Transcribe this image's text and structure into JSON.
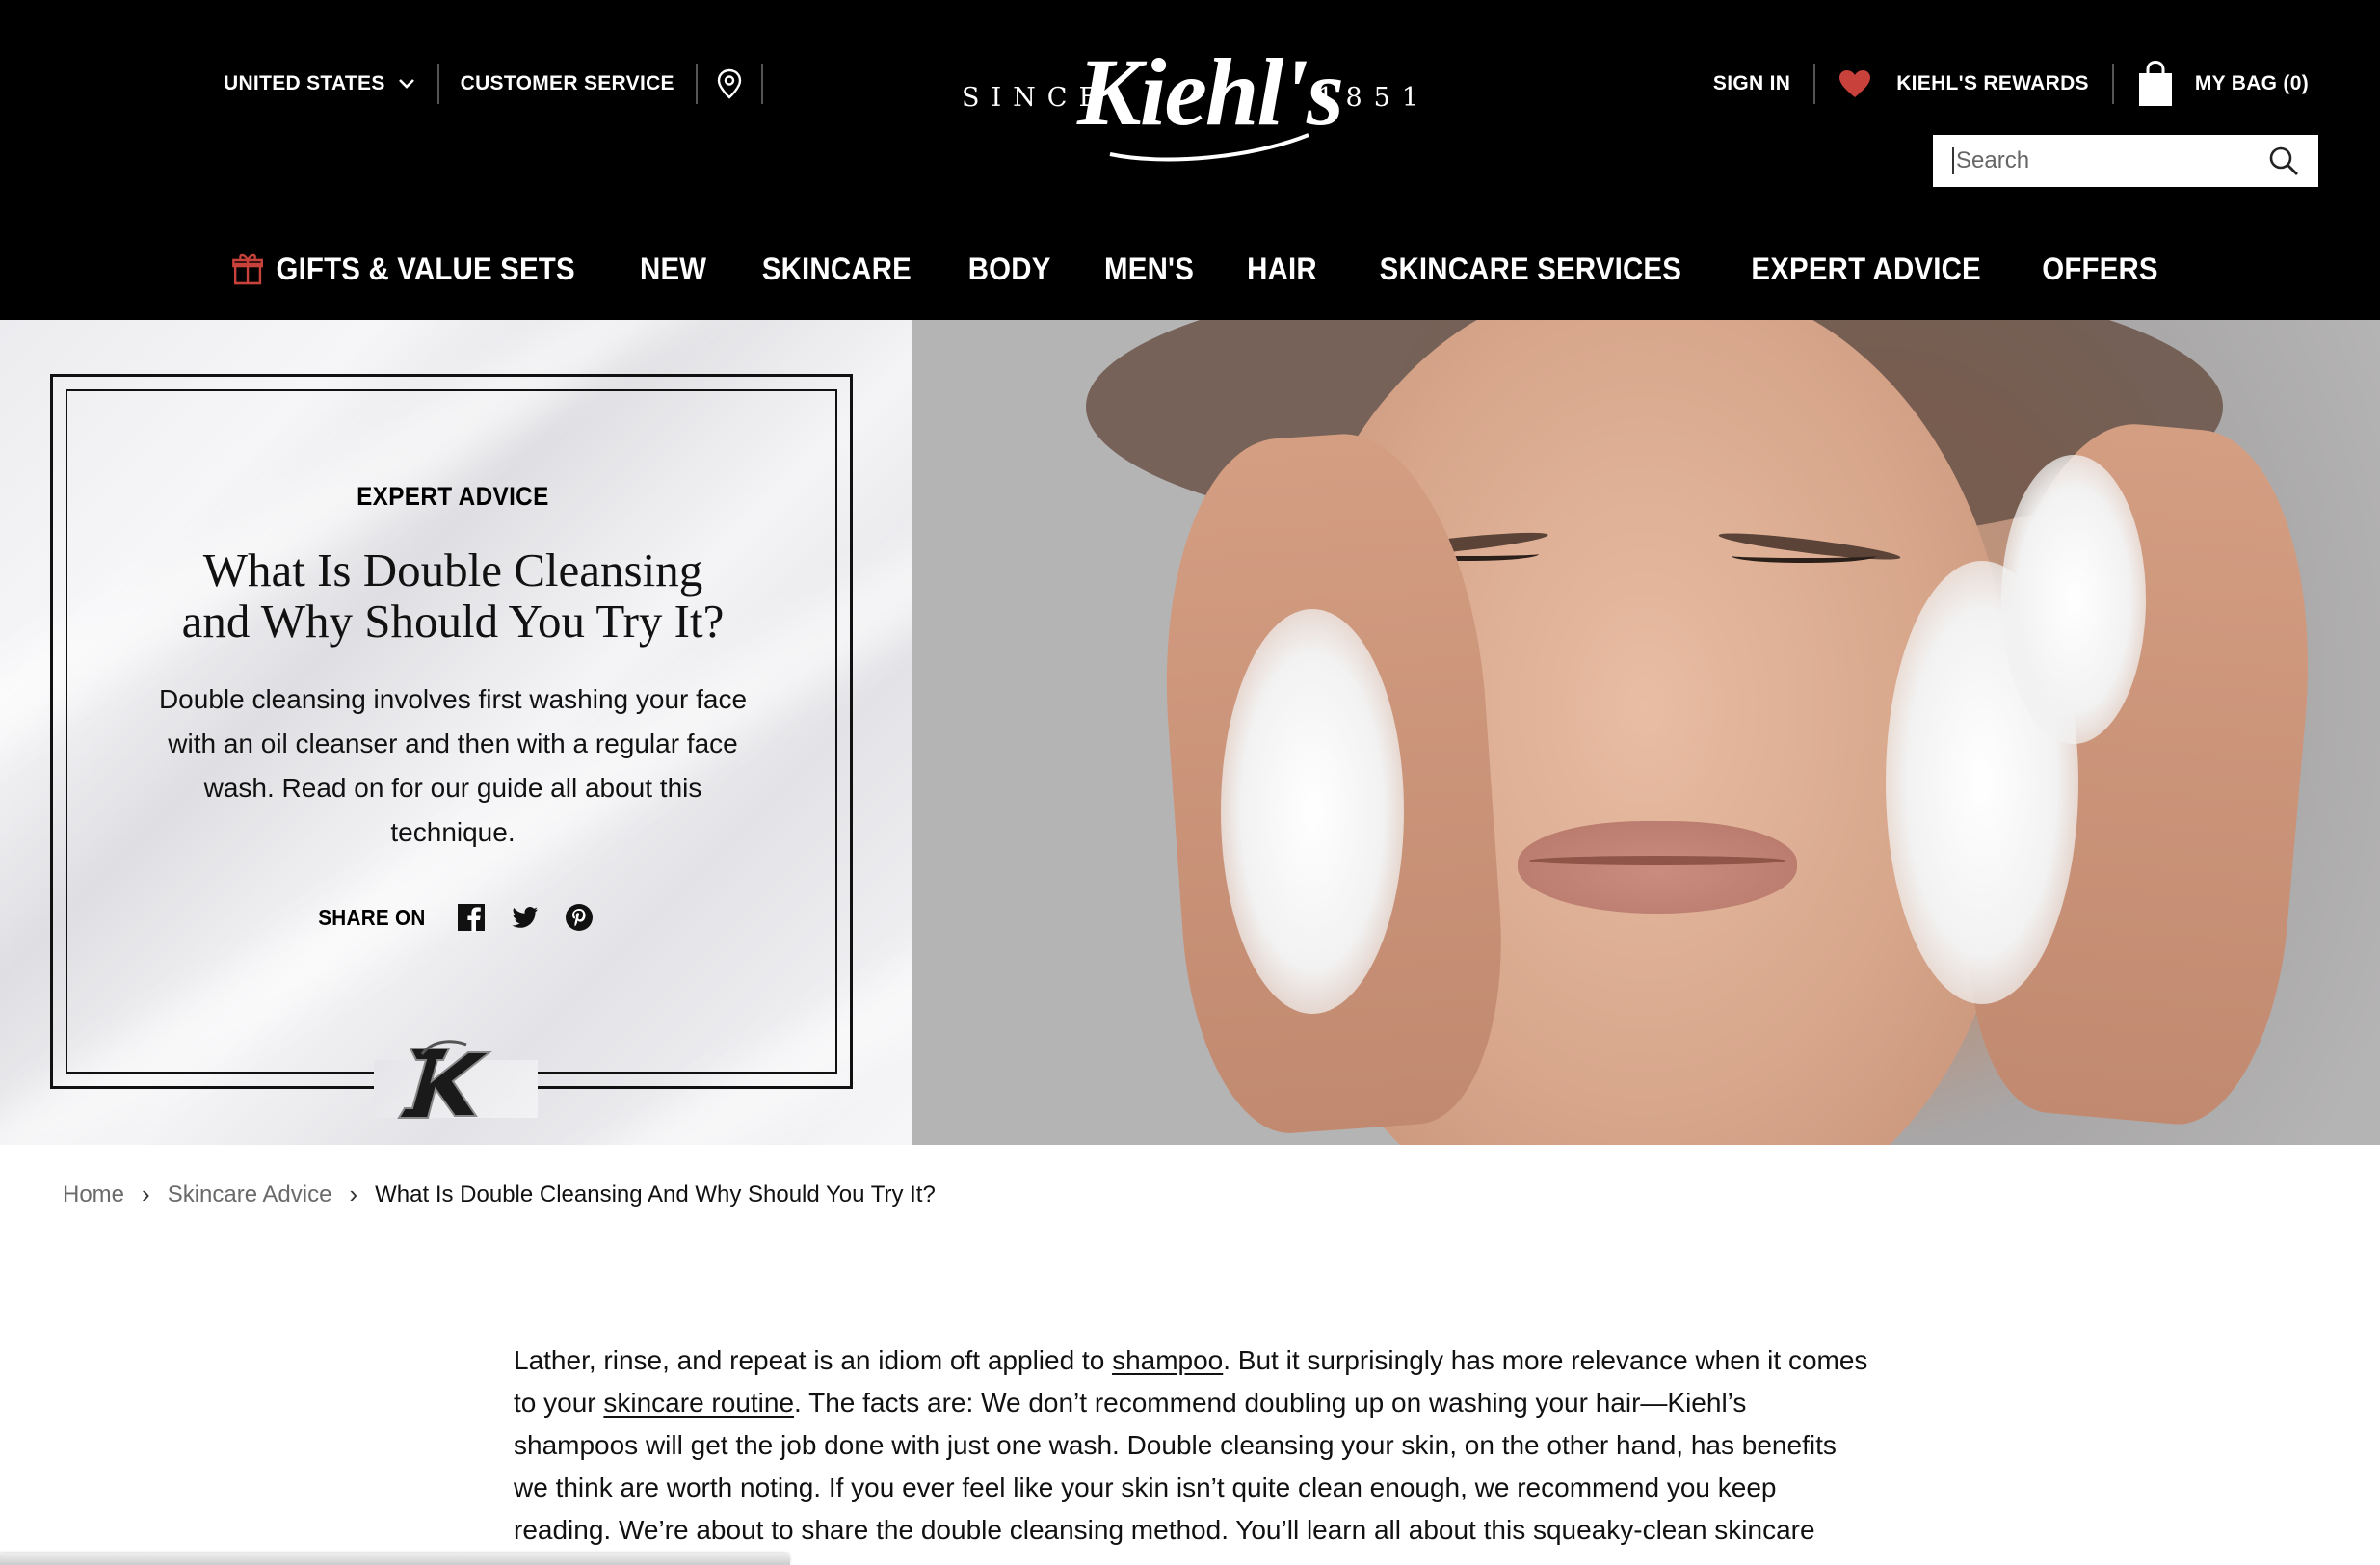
{
  "header": {
    "country": "UNITED STATES",
    "customer_service": "CUSTOMER SERVICE",
    "logo": {
      "since": "SINCE",
      "name": "Kiehl's",
      "year": "1851"
    },
    "sign_in": "SIGN IN",
    "rewards": "KIEHL'S REWARDS",
    "bag": "MY BAG (0)",
    "search_placeholder": "Search",
    "nav": [
      "GIFTS & VALUE SETS",
      "NEW",
      "SKINCARE",
      "BODY",
      "MEN'S",
      "HAIR",
      "SKINCARE SERVICES",
      "EXPERT ADVICE",
      "OFFERS"
    ],
    "colors": {
      "background": "#000000",
      "text": "#ffffff",
      "accent": "#c9413b"
    }
  },
  "hero": {
    "eyebrow": "EXPERT ADVICE",
    "headline_line1": "What Is Double Cleansing",
    "headline_line2": "and Why Should You Try It?",
    "dek": "Double cleansing involves first washing your face with an oil cleanser and then with a regular face wash. Read on for our guide all about this technique.",
    "share_label": "SHARE ON",
    "share_icons": [
      "facebook-icon",
      "twitter-icon",
      "pinterest-icon"
    ]
  },
  "breadcrumb": {
    "home": "Home",
    "section": "Skincare Advice",
    "current": "What Is Double Cleansing And Why Should You Try It?"
  },
  "article": {
    "p1_a": "Lather, rinse, and repeat is an idiom oft applied to ",
    "p1_link1": "shampoo",
    "p1_b": ". But it surprisingly has more relevance when it comes to your ",
    "p1_link2": "skincare routine",
    "p1_c": ". The facts are: We don’t recommend doubling up on washing your hair—Kiehl’s shampoos will get the job done with just one wash. Double cleansing your skin, on the other hand, has benefits we think are worth noting. If you ever feel like your skin isn’t quite clean enough, we recommend you keep reading. We’re about to share the double cleansing method. You’ll learn all about this squeaky-clean skincare technique, including"
  }
}
